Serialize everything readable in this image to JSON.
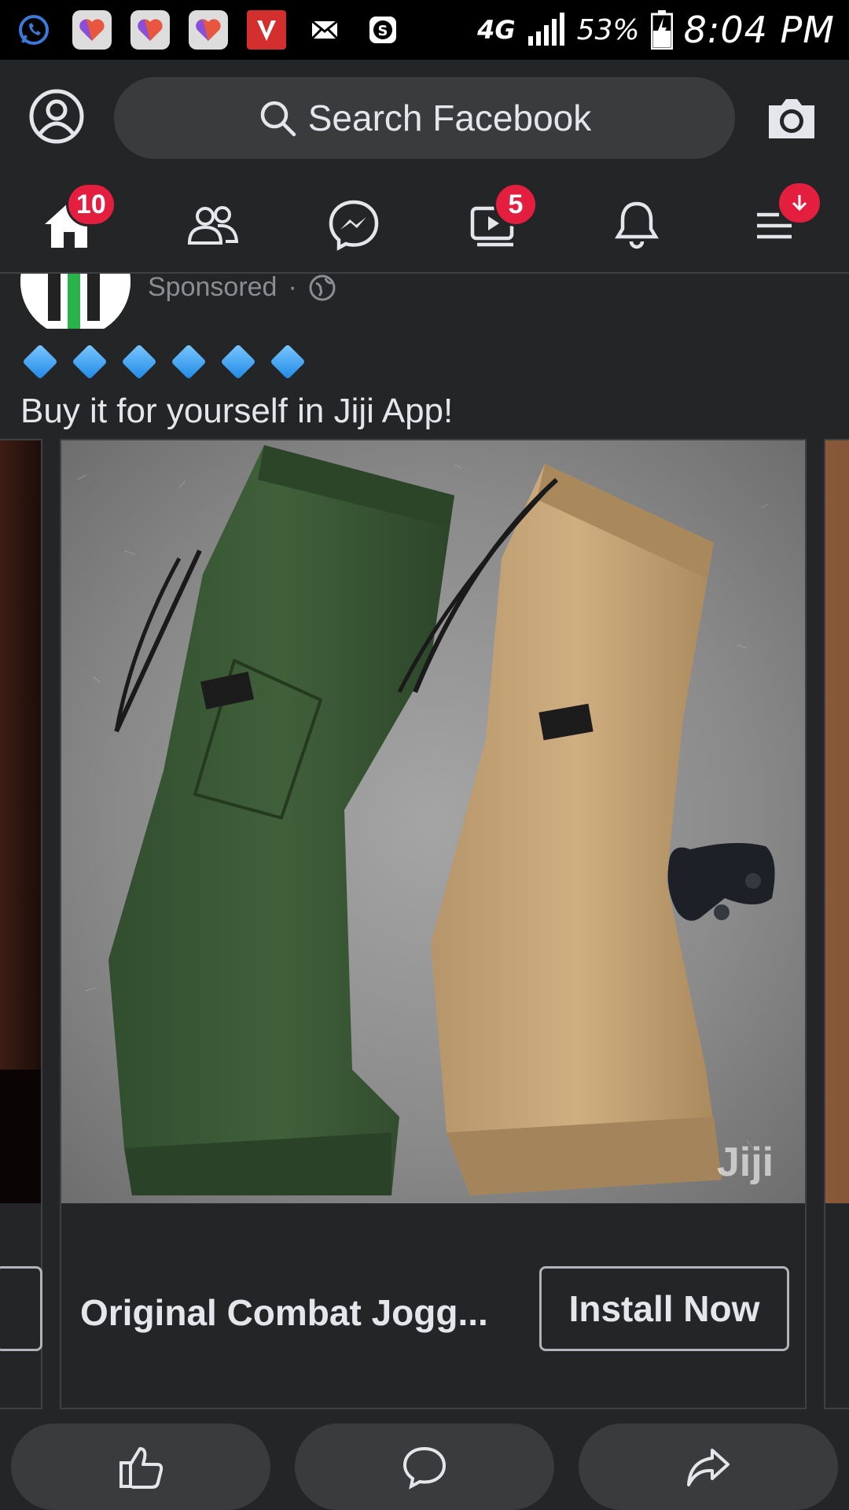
{
  "status_bar": {
    "network": "4G",
    "battery_percent": "53%",
    "time": "8:04 PM",
    "notification_icons": [
      "whatsapp-icon",
      "dating-app-icon",
      "dating-app-icon",
      "dating-app-icon",
      "vidmate-icon",
      "mail-icon",
      "skype-icon"
    ]
  },
  "header": {
    "search_placeholder": "Search Facebook"
  },
  "nav": {
    "home_badge": "10",
    "watch_badge": "5"
  },
  "post": {
    "sponsored_label": "Sponsored",
    "text": "Buy it for yourself in Jiji App!",
    "diamond_count": 6,
    "watermark": "Jiji",
    "card": {
      "title": "Original Combat Jogg...",
      "cta_label": "Install Now"
    }
  },
  "colors": {
    "background": "#242526",
    "surface": "#3a3b3c",
    "badge": "#e41e3f",
    "text": "#e4e6eb"
  }
}
